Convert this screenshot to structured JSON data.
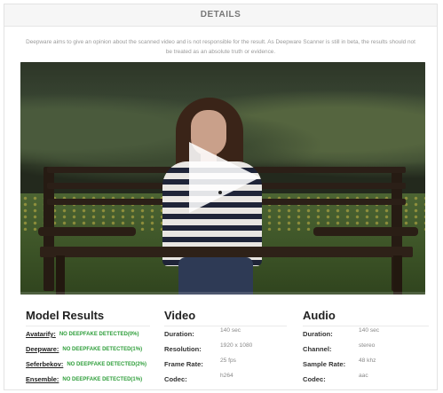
{
  "header": {
    "title": "DETAILS"
  },
  "disclaimer": "Deepware aims to give an opinion about the scanned video and is not responsible for the result. As Deepware Scanner is still in beta, the results should not be treated as an absolute truth or evidence.",
  "player": {
    "play_icon": "play-icon",
    "progress": 0
  },
  "model_results": {
    "title": "Model Results",
    "rows": [
      {
        "name": "Avatarify:",
        "result": "NO DEEPFAKE DETECTED(0%)"
      },
      {
        "name": "Deepware:",
        "result": "NO DEEPFAKE DETECTED(1%)"
      },
      {
        "name": "Seferbekov:",
        "result": "NO DEEPFAKE DETECTED(2%)"
      },
      {
        "name": "Ensemble:",
        "result": "NO DEEPFAKE DETECTED(1%)"
      }
    ],
    "status_color": "#2e9e3a"
  },
  "video_info": {
    "title": "Video",
    "rows": [
      {
        "key": "Duration:",
        "value": "140 sec"
      },
      {
        "key": "Resolution:",
        "value": "1920 x 1080"
      },
      {
        "key": "Frame Rate:",
        "value": "25 fps"
      },
      {
        "key": "Codec:",
        "value": "h264"
      }
    ]
  },
  "audio_info": {
    "title": "Audio",
    "rows": [
      {
        "key": "Duration:",
        "value": "140 sec"
      },
      {
        "key": "Channel:",
        "value": "stereo"
      },
      {
        "key": "Sample Rate:",
        "value": "48 khz"
      },
      {
        "key": "Codec:",
        "value": "aac"
      }
    ]
  }
}
